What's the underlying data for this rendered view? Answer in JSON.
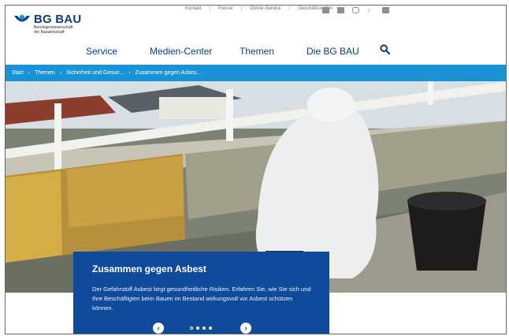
{
  "utility": {
    "links": [
      "Kontakt",
      "Presse",
      "Online-Service",
      "Geschäftsstellen"
    ]
  },
  "logo": {
    "brand": "BG BAU",
    "subtitle_line1": "Berufsgenossenschaft",
    "subtitle_line2": "der Bauwirtschaft"
  },
  "nav": {
    "items": [
      "Service",
      "Medien-Center",
      "Themen",
      "Die BG BAU"
    ]
  },
  "breadcrumb": {
    "items": [
      "Start",
      "Themen",
      "Sicherheit und Gesun...",
      "Zusammen gegen Asbes..."
    ]
  },
  "teaser": {
    "title": "Zusammen gegen Asbest",
    "text": "Der Gefahrstoff Asbest birgt gesundheitliche Risiken. Erfahren Sie, wie Sie sich und Ihre Beschäftigten beim Bauen im Bestand wirkungsvoll vor Asbest schützen können.",
    "slider": {
      "current": 1,
      "total": 4
    }
  },
  "colors": {
    "brand_blue": "#0b3d86",
    "breadcrumb_bg": "#1a93d6",
    "teaser_bg": "#0f4a9b"
  }
}
